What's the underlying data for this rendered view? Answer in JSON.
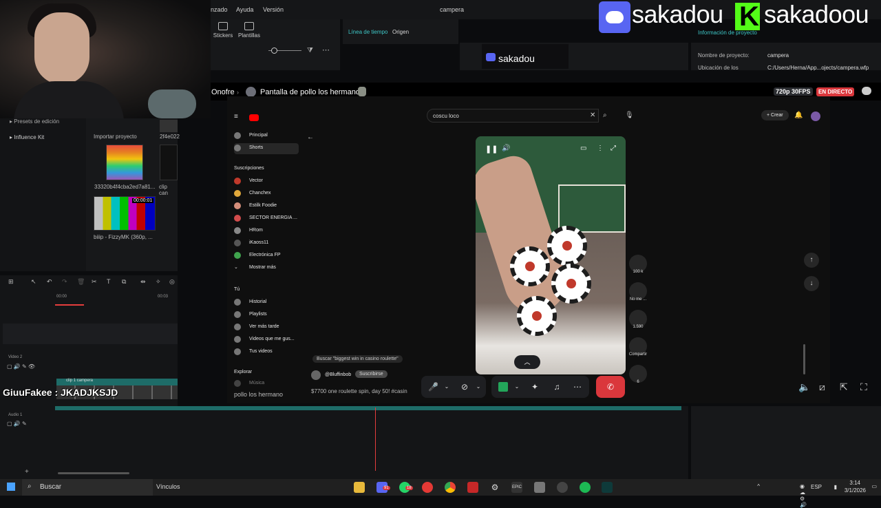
{
  "editor": {
    "menu": {
      "item1": "nzado",
      "item2": "Ayuda",
      "item3": "Versión",
      "title": "campera"
    },
    "tools": {
      "stickers": "Stickers",
      "templates": "Plantillas"
    },
    "tabs": {
      "timeline": "Línea de tiempo",
      "origin": "Origen"
    },
    "project_info": {
      "header": "Información de proyecto",
      "name_label": "Nombre de proyecto:",
      "name_value": "campera",
      "location_label": "Ubicación de los",
      "location_value": "C:/Users/Herna/App...ojects/campera.wfp"
    },
    "side_menu": {
      "presets": "Presets de edición",
      "influence": "Influence Kit"
    },
    "media": {
      "import_label": "Importar proyecto",
      "id_fragment": "2f4e022",
      "clip1_name": "33320b4f4cba2ed7a81...",
      "clip2_name": "clip can",
      "clip3_name": "biiip - FizzyMK (360p, ...",
      "clip3_duration": "00:00:01"
    },
    "timeline": {
      "time_start": "00:00",
      "time_mark": "00:03",
      "track_video": "Video 2",
      "track_audio": "Audio 1",
      "clip_label": "clip 1 campera"
    }
  },
  "overlay": {
    "discord_name": "sakadou",
    "kick_name": "sakadoou",
    "preview_name": "sakadou"
  },
  "stream": {
    "user": "Onofre",
    "title": "Pantalla de pollo los hermano",
    "quality": "720p 30FPS",
    "live": "EN DIRECTO",
    "mute_label": "pollo los hermano"
  },
  "youtube": {
    "search_value": "coscu loco",
    "nav": [
      {
        "label": "Principal"
      },
      {
        "label": "Shorts"
      },
      {
        "label": "Suscripciones"
      },
      {
        "label": "Vector"
      },
      {
        "label": "Chanchex"
      },
      {
        "label": "Estilk Foodie"
      },
      {
        "label": "SECTOR ENERGIA ..."
      },
      {
        "label": "HRom"
      },
      {
        "label": "iKaoss11"
      },
      {
        "label": "Electrónica FP"
      },
      {
        "label": "Mostrar más"
      },
      {
        "label": "Tú"
      },
      {
        "label": "Historial"
      },
      {
        "label": "Playlists"
      },
      {
        "label": "Ver más tarde"
      },
      {
        "label": "Videos que me gus..."
      },
      {
        "label": "Tus videos"
      },
      {
        "label": "Explorar"
      },
      {
        "label": "Música"
      }
    ],
    "create_label": "Crear",
    "actions": {
      "likes": "100 k",
      "dislike": "No me ...",
      "comments": "1.590",
      "share": "Compartir",
      "remix": "6"
    },
    "short": {
      "search_hint": "Buscar \"biggest win in casino roulette\"",
      "channel": "@Bluffinbob",
      "subscribe": "Suscribirse",
      "caption": "$7700 one roulette spin, day 50! #casin"
    }
  },
  "chat": {
    "line": "GiuuFakee : JKADJKSJD"
  },
  "taskbar": {
    "search": "Buscar",
    "links": "Vínculos",
    "discord_badge": "91",
    "whatsapp_badge": "18",
    "lang": "ESP",
    "time": "3:14",
    "date": "3/1/2026"
  },
  "colors": {
    "discord": "#5865f2",
    "kick": "#53fc18",
    "live": "#da373c",
    "playhead": "#e63d3d",
    "clip": "#1e6c68"
  }
}
